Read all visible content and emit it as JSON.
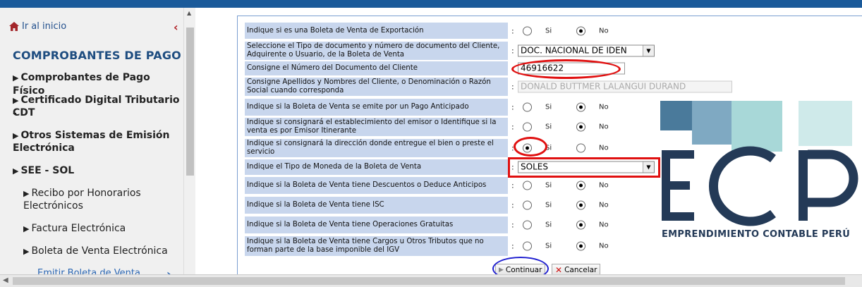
{
  "sidebar": {
    "home_label": "Ir al inicio",
    "section_title": "COMPROBANTES DE PAGO",
    "items": [
      {
        "label": "Comprobantes de Pago Físico"
      },
      {
        "label": "Certificado Digital Tributario -"
      },
      {
        "label": "CDT"
      },
      {
        "label": "Otros Sistemas de Emisión"
      },
      {
        "label": "Electrónica"
      },
      {
        "label": "SEE - SOL"
      },
      {
        "label": "Recibo por Honorarios"
      },
      {
        "label": "Electrónicos"
      },
      {
        "label": "Factura Electrónica"
      },
      {
        "label": "Boleta de Venta Electrónica"
      },
      {
        "label": "Emitir Boleta de Venta"
      }
    ]
  },
  "radio": {
    "yes": "Si",
    "no": "No"
  },
  "form": {
    "rows": [
      {
        "label": "Indique si es una Boleta de Venta de Exportación",
        "selected": "No"
      },
      {
        "label": "Seleccione el Tipo de documento y número de documento del Cliente, Adquirente o Usuario, de la Boleta de Venta",
        "value": "DOC. NACIONAL DE IDEN"
      },
      {
        "label": "Consigne el Número del Documento del Cliente",
        "value": "46916622"
      },
      {
        "label": "Consigne Apellidos y Nombres del Cliente, o Denominación o Razón Social cuando corresponda",
        "value": "DONALD BUTTMER LALANGUI DURAND"
      },
      {
        "label": "Indique si la Boleta de Venta se emite por un Pago Anticipado",
        "selected": "No"
      },
      {
        "label": "Indique si consignará el establecimiento del emisor o Identifique si la venta es por Emisor Itinerante",
        "selected": "No"
      },
      {
        "label": "Indique si consignará la dirección donde entregue el bien o preste el servicio",
        "selected": "Si"
      },
      {
        "label": "Indique el Tipo de Moneda de la Boleta de Venta",
        "value": "SOLES"
      },
      {
        "label": "Indique si la Boleta de Venta tiene Descuentos o Deduce Anticipos",
        "selected": "No"
      },
      {
        "label": "Indique si la Boleta de Venta tiene ISC",
        "selected": "No"
      },
      {
        "label": "Indique si la Boleta de Venta tiene Operaciones Gratuitas",
        "selected": "No"
      },
      {
        "label": "Indique si la Boleta de Venta tiene Cargos u Otros Tributos que no forman parte de la base imponible del IGV",
        "selected": "No"
      }
    ]
  },
  "buttons": {
    "continue": "Continuar",
    "cancel": "Cancelar"
  },
  "logo": {
    "letters": "ECP",
    "caption": "EMPRENDIMIENTO CONTABLE PERÚ"
  },
  "colors": {
    "topbar": "#1a5a9a",
    "label_bg": "#c8d6ed",
    "annotation_red": "#e01010",
    "annotation_blue": "#2020d0",
    "logo_navy": "#243a57",
    "logo_teal": "#4a7a9b",
    "logo_mint": "#a8d8d8"
  }
}
